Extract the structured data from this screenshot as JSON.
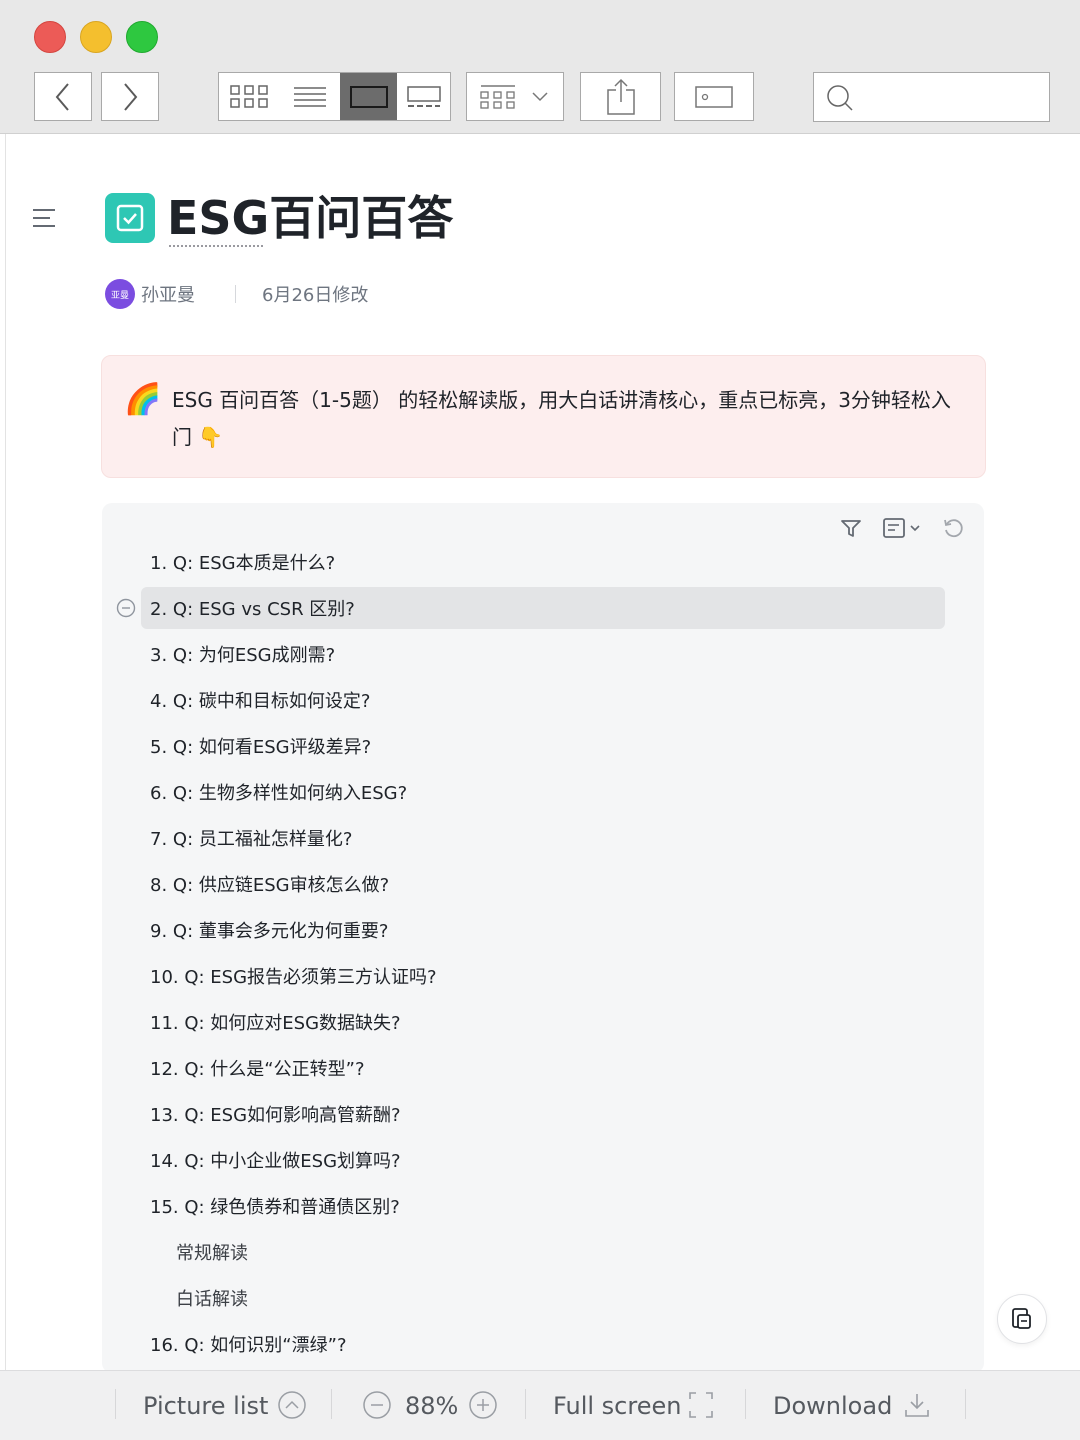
{
  "window": {
    "colors": {
      "close": "#ec5b57",
      "minimize": "#f4bf2e",
      "zoom": "#2ec840"
    }
  },
  "toolbar": {
    "icons": [
      "chevron-left-icon",
      "chevron-right-icon",
      "icon-grid-icon",
      "list-view-icon",
      "single-view-icon",
      "filmstrip-view-icon",
      "group-icon",
      "share-icon",
      "tag-icon",
      "search-icon"
    ],
    "search_value": ""
  },
  "doc": {
    "title": "ESG百问百答",
    "author": "孙亚曼",
    "avatar_text": "亚曼",
    "modified": "6月26日修改",
    "callout": {
      "emoji_start": "🌈",
      "text": "ESG 百问百答（1-5题） 的轻松解读版，用大白话讲清核心，重点已标亮，3分钟轻松入门",
      "emoji_end": "👇",
      "background": "#fdeeee"
    },
    "accent": "#2ec7b4"
  },
  "toc": {
    "items": [
      {
        "label": "1. Q: ESG本质是什么?"
      },
      {
        "label": "2. Q: ESG vs CSR 区别?"
      },
      {
        "label": "3. Q: 为何ESG成刚需?"
      },
      {
        "label": "4. Q: 碳中和目标如何设定?"
      },
      {
        "label": "5. Q: 如何看ESG评级差异?"
      },
      {
        "label": "6. Q: 生物多样性如何纳入ESG?"
      },
      {
        "label": "7. Q: 员工福祉怎样量化?"
      },
      {
        "label": "8. Q: 供应链ESG审核怎么做?"
      },
      {
        "label": "9. Q: 董事会多元化为何重要?"
      },
      {
        "label": "10. Q: ESG报告必须第三方认证吗?"
      },
      {
        "label": "11. Q: 如何应对ESG数据缺失?"
      },
      {
        "label": "12. Q: 什么是“公正转型”?"
      },
      {
        "label": "13. Q: ESG如何影响高管薪酬?"
      },
      {
        "label": "14. Q: 中小企业做ESG划算吗?"
      },
      {
        "label": "15. Q: 绿色债券和普通债区别?"
      },
      {
        "label": "常规解读"
      },
      {
        "label": "白话解读"
      },
      {
        "label": "16. Q: 如何识别“漂绿”?"
      }
    ]
  },
  "bottombar": {
    "picture_list": "Picture list",
    "zoom": "88%",
    "full_screen": "Full screen",
    "download": "Download"
  }
}
